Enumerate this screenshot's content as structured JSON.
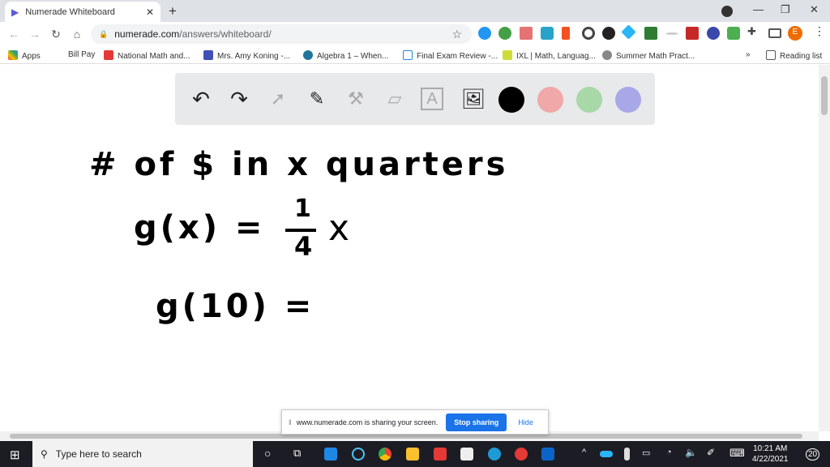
{
  "browser": {
    "tab_title": "Numerade Whiteboard",
    "url_domain": "numerade.com",
    "url_path": "/answers/whiteboard/",
    "profile_initial": "E"
  },
  "bookmarks": [
    "Apps",
    "Bill Pay",
    "National Math and...",
    "Mrs. Amy Koning -...",
    "Algebra 1 – When...",
    "Final Exam Review -...",
    "IXL | Math, Languag...",
    "Summer Math Pract..."
  ],
  "reading_list": "Reading list",
  "toolbar": {
    "tools": [
      "undo-icon",
      "redo-icon",
      "pointer-icon",
      "pen-icon",
      "tools-icon",
      "eraser-icon",
      "text-icon",
      "image-icon"
    ],
    "colors": [
      "#000000",
      "#f0a8a8",
      "#a8d8a8",
      "#a8a8e8"
    ]
  },
  "whiteboard": {
    "line1": "# of $ in x quarters",
    "line2": "g(x) =",
    "frac_num": "1",
    "frac_den": "4",
    "line2_var": "x",
    "line3": "g(10) ="
  },
  "share_bar": {
    "message": "www.numerade.com is sharing your screen.",
    "stop": "Stop sharing",
    "hide": "Hide"
  },
  "taskbar": {
    "search_placeholder": "Type here to search",
    "time": "10:21 AM",
    "date": "4/22/2021",
    "notifications": "20"
  }
}
